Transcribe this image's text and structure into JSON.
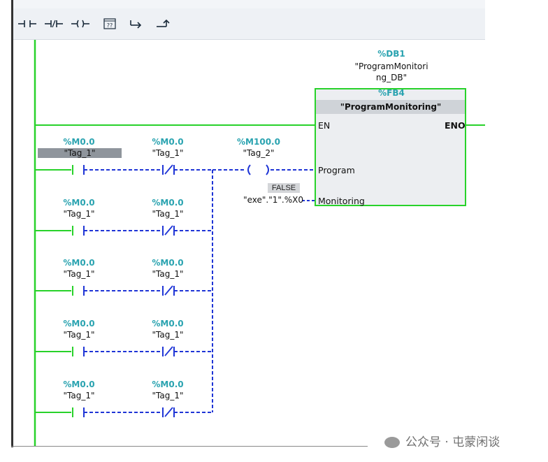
{
  "toolbar": {
    "buttons": [
      {
        "name": "no-contact-button",
        "icon": "no-contact-icon"
      },
      {
        "name": "nc-contact-button",
        "icon": "nc-contact-icon"
      },
      {
        "name": "coil-button",
        "icon": "coil-icon"
      },
      {
        "name": "empty-box-button",
        "icon": "empty-box-icon",
        "label": "??"
      },
      {
        "name": "open-branch-button",
        "icon": "open-branch-icon"
      },
      {
        "name": "close-branch-button",
        "icon": "close-branch-icon"
      }
    ]
  },
  "fb": {
    "db_addr": "%DB1",
    "db_name_line1": "\"ProgramMonitori",
    "db_name_line2": "ng_DB\"",
    "fb_addr": "%FB4",
    "fb_name": "\"ProgramMonitoring\"",
    "pin_en": "EN",
    "pin_eno": "ENO",
    "pin_program": "Program",
    "pin_monitoring": "Monitoring",
    "monitoring_value": "FALSE",
    "monitoring_operand": "\"exe\".\"1\".%X0"
  },
  "coil": {
    "addr": "%M100.0",
    "tag": "\"Tag_2\""
  },
  "rows": [
    {
      "no_addr": "%M0.0",
      "no_tag": "\"Tag_1\"",
      "nc_addr": "%M0.0",
      "nc_tag": "\"Tag_1\""
    },
    {
      "no_addr": "%M0.0",
      "no_tag": "\"Tag_1\"",
      "nc_addr": "%M0.0",
      "nc_tag": "\"Tag_1\""
    },
    {
      "no_addr": "%M0.0",
      "no_tag": "\"Tag_1\"",
      "nc_addr": "%M0.0",
      "nc_tag": "\"Tag_1\""
    },
    {
      "no_addr": "%M0.0",
      "no_tag": "\"Tag_1\"",
      "nc_addr": "%M0.0",
      "nc_tag": "\"Tag_1\""
    },
    {
      "no_addr": "%M0.0",
      "no_tag": "\"Tag_1\"",
      "nc_addr": "%M0.0",
      "nc_tag": "\"Tag_1\""
    }
  ],
  "colors": {
    "power_rail": "#28d22a",
    "unpowered": "#1f35d6",
    "address": "#2aa3b0"
  },
  "watermark": {
    "text": "公众号 · 屯蒙闲谈"
  }
}
